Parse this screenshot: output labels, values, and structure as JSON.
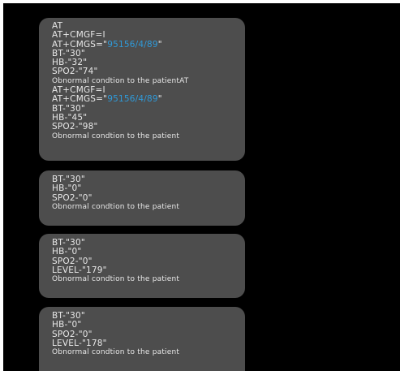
{
  "messages": [
    {
      "lines": [
        {
          "text": "AT"
        },
        {
          "text": "AT+CMGF=I"
        },
        {
          "prefix": "AT+CMGS=\"",
          "number": "95156/4/89",
          "suffix": "\""
        },
        {
          "text": "BT-\"30\""
        },
        {
          "text": "HB-\"32\""
        },
        {
          "text": "SPO2-\"74\""
        },
        {
          "text": "Obnormal condtion to the patientAT",
          "small": true
        },
        {
          "text": "AT+CMGF=I"
        },
        {
          "prefix": "AT+CMGS=\"",
          "number": "95156/4/89",
          "suffix": "\""
        },
        {
          "text": "BT-\"30\""
        },
        {
          "text": "HB-\"45\""
        },
        {
          "text": "SPO2-\"98\""
        },
        {
          "text": "Obnormal condtion to the patient",
          "small": true
        }
      ]
    },
    {
      "lines": [
        {
          "text": "BT-\"30\""
        },
        {
          "text": "HB-\"0\""
        },
        {
          "text": "SPO2-\"0\""
        },
        {
          "text": "Obnormal condtion to the patient",
          "small": true
        }
      ]
    },
    {
      "lines": [
        {
          "text": "BT-\"30\""
        },
        {
          "text": "HB-\"0\""
        },
        {
          "text": "SPO2-\"0\""
        },
        {
          "text": "LEVEL-\"179\""
        },
        {
          "text": "Obnormal condtion to the patient",
          "small": true
        }
      ]
    },
    {
      "lines": [
        {
          "text": "BT-\"30\""
        },
        {
          "text": "HB-\"0\""
        },
        {
          "text": "SPO2-\"0\""
        },
        {
          "text": "LEVEL-\"178\""
        },
        {
          "text": "Obnormal condtion to the patient",
          "small": true
        }
      ]
    }
  ],
  "colors": {
    "background": "#000000",
    "bubble": "#4d4d4d",
    "text": "#e8e8e8",
    "phone_link": "#2f9ad9"
  }
}
